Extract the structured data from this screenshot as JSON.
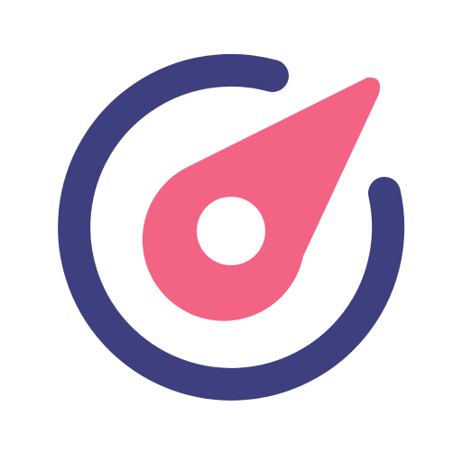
{
  "icon": {
    "name": "speedometer-icon",
    "colors": {
      "ring": "#3E3F7F",
      "needle": "#F26384",
      "hole": "#FFFFFF",
      "background": "#FFFFFF"
    }
  }
}
